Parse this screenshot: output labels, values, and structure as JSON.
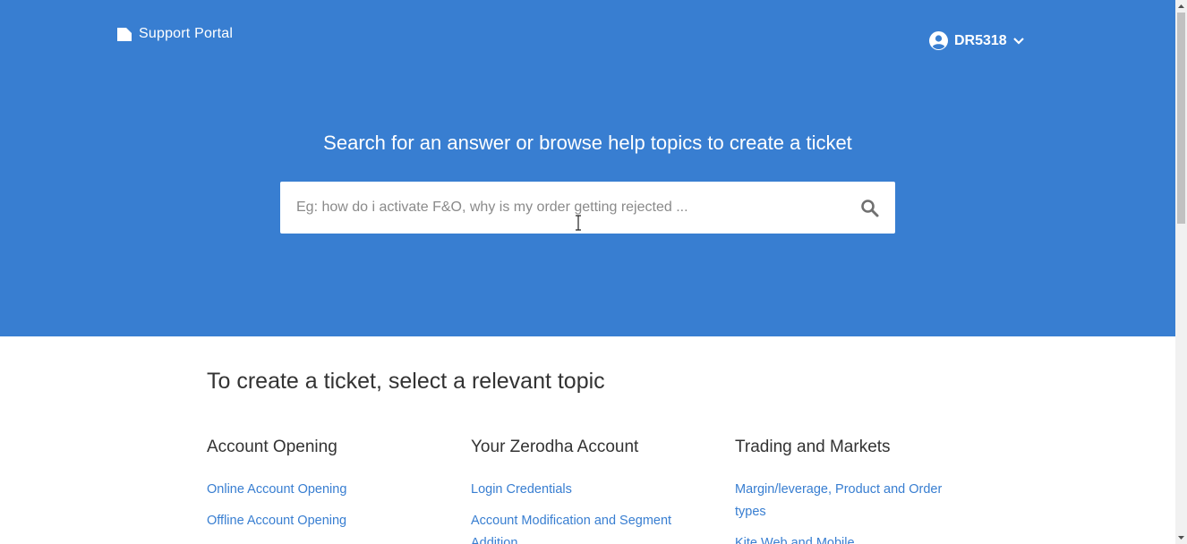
{
  "colors": {
    "brand": "#387ed1",
    "text": "#333333",
    "link": "#387ed1"
  },
  "header": {
    "brand_label": "Support Portal",
    "brand_icon": "portal-logo-icon",
    "user": {
      "id": "DR5318",
      "avatar_icon": "user-circle-icon",
      "menu_icon": "chevron-down-icon"
    }
  },
  "hero": {
    "title": "Search for an answer or browse help topics to create a ticket",
    "search": {
      "placeholder": "Eg: how do i activate F&O, why is my order getting rejected ...",
      "value": "",
      "icon": "search-icon"
    }
  },
  "topics": {
    "heading": "To create a ticket, select a relevant topic",
    "columns": [
      {
        "title": "Account Opening",
        "links": [
          "Online Account Opening",
          "Offline Account Opening"
        ]
      },
      {
        "title": "Your Zerodha Account",
        "links": [
          "Login Credentials",
          "Account Modification and Segment Addition"
        ]
      },
      {
        "title": "Trading and Markets",
        "links": [
          "Margin/leverage, Product and Order types",
          "Kite Web and Mobile"
        ]
      }
    ]
  }
}
